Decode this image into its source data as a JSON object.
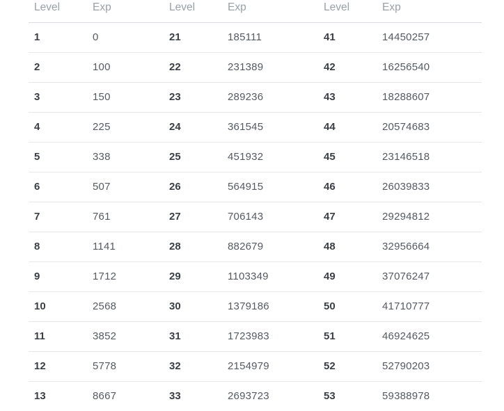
{
  "table": {
    "headers": [
      "Level",
      "Exp",
      "Level",
      "Exp",
      "Level",
      "Exp"
    ],
    "rows": [
      [
        {
          "level": "1",
          "exp": "0"
        },
        {
          "level": "21",
          "exp": "185111"
        },
        {
          "level": "41",
          "exp": "14450257"
        }
      ],
      [
        {
          "level": "2",
          "exp": "100"
        },
        {
          "level": "22",
          "exp": "231389"
        },
        {
          "level": "42",
          "exp": "16256540"
        }
      ],
      [
        {
          "level": "3",
          "exp": "150"
        },
        {
          "level": "23",
          "exp": "289236"
        },
        {
          "level": "43",
          "exp": "18288607"
        }
      ],
      [
        {
          "level": "4",
          "exp": "225"
        },
        {
          "level": "24",
          "exp": "361545"
        },
        {
          "level": "44",
          "exp": "20574683"
        }
      ],
      [
        {
          "level": "5",
          "exp": "338"
        },
        {
          "level": "25",
          "exp": "451932"
        },
        {
          "level": "45",
          "exp": "23146518"
        }
      ],
      [
        {
          "level": "6",
          "exp": "507"
        },
        {
          "level": "26",
          "exp": "564915"
        },
        {
          "level": "46",
          "exp": "26039833"
        }
      ],
      [
        {
          "level": "7",
          "exp": "761"
        },
        {
          "level": "27",
          "exp": "706143"
        },
        {
          "level": "47",
          "exp": "29294812"
        }
      ],
      [
        {
          "level": "8",
          "exp": "1141"
        },
        {
          "level": "28",
          "exp": "882679"
        },
        {
          "level": "48",
          "exp": "32956664"
        }
      ],
      [
        {
          "level": "9",
          "exp": "1712"
        },
        {
          "level": "29",
          "exp": "1103349"
        },
        {
          "level": "49",
          "exp": "37076247"
        }
      ],
      [
        {
          "level": "10",
          "exp": "2568"
        },
        {
          "level": "30",
          "exp": "1379186"
        },
        {
          "level": "50",
          "exp": "41710777"
        }
      ],
      [
        {
          "level": "11",
          "exp": "3852"
        },
        {
          "level": "31",
          "exp": "1723983"
        },
        {
          "level": "51",
          "exp": "46924625"
        }
      ],
      [
        {
          "level": "12",
          "exp": "5778"
        },
        {
          "level": "32",
          "exp": "2154979"
        },
        {
          "level": "52",
          "exp": "52790203"
        }
      ],
      [
        {
          "level": "13",
          "exp": "8667"
        },
        {
          "level": "33",
          "exp": "2693723"
        },
        {
          "level": "53",
          "exp": "59388978"
        }
      ]
    ]
  },
  "colors": {
    "header_text": "#98a0a8",
    "level_text": "#3a3e45",
    "exp_text": "#555a61",
    "row_divider": "#e6e8eb",
    "header_divider": "#d8dbdf",
    "background": "#ffffff"
  }
}
